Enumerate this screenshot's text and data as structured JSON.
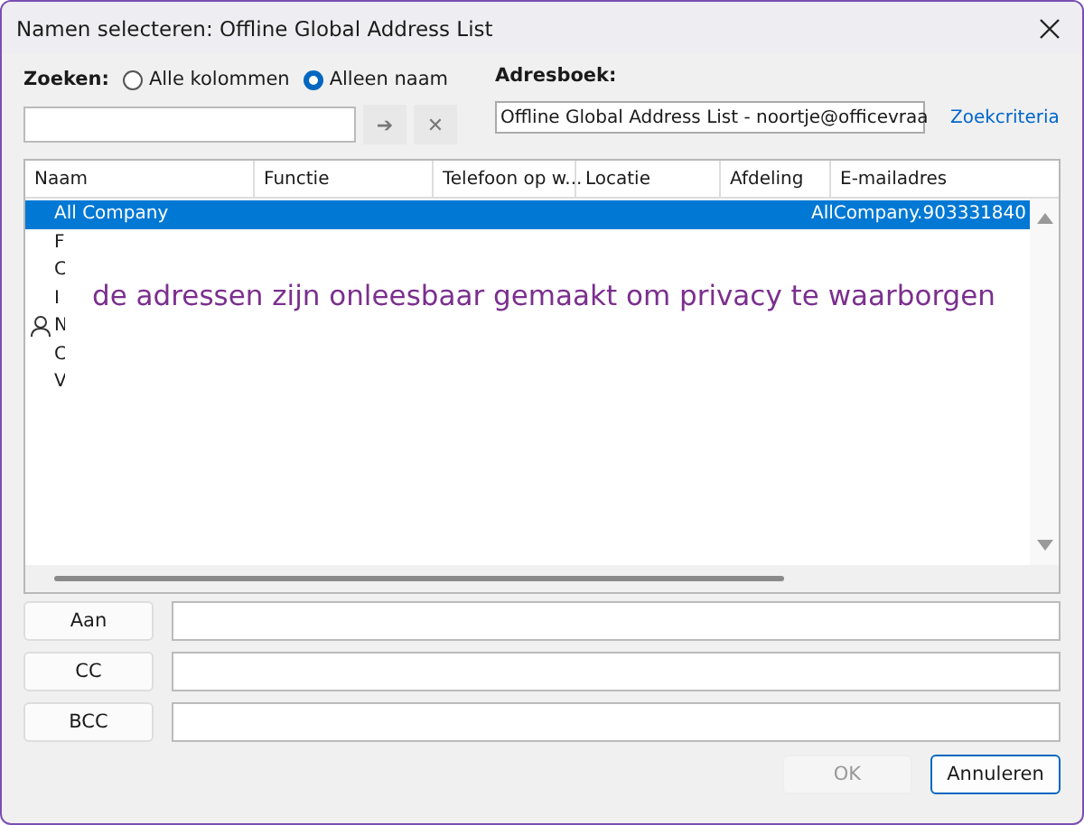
{
  "window": {
    "title": "Namen selecteren: Offline Global Address List"
  },
  "search": {
    "label": "Zoeken:",
    "options": [
      {
        "label": "Alle kolommen",
        "selected": false
      },
      {
        "label": "Alleen naam",
        "selected": true
      }
    ],
    "go_symbol": "➔",
    "clear_symbol": "✕"
  },
  "address_book": {
    "label": "Adresboek:",
    "value": "Offline Global Address List - noortje@officevraa",
    "link": "Zoekcriteria"
  },
  "table": {
    "columns": [
      "Naam",
      "Functie",
      "Telefoon op w...",
      "Locatie",
      "Afdeling",
      "E-mailadres"
    ],
    "rows": [
      {
        "name": "All Company",
        "email": "AllCompany.903331840",
        "selected": true,
        "kind": "group"
      },
      {
        "name": "F",
        "selected": false,
        "kind": "group"
      },
      {
        "name": "C",
        "selected": false,
        "kind": "group"
      },
      {
        "name": "I",
        "selected": false,
        "kind": "group"
      },
      {
        "name": "N",
        "selected": false,
        "kind": "person"
      },
      {
        "name": "C",
        "selected": false,
        "kind": "group"
      },
      {
        "name": "V",
        "selected": false,
        "kind": "group"
      }
    ]
  },
  "overlay": {
    "text": "de adressen zijn onleesbaar gemaakt om privacy te waarborgen"
  },
  "recipients": [
    {
      "label": "Aan"
    },
    {
      "label": "CC"
    },
    {
      "label": "BCC"
    }
  ],
  "buttons": [
    {
      "label": "OK",
      "disabled": true
    },
    {
      "label": "Annuleren",
      "disabled": false
    }
  ]
}
